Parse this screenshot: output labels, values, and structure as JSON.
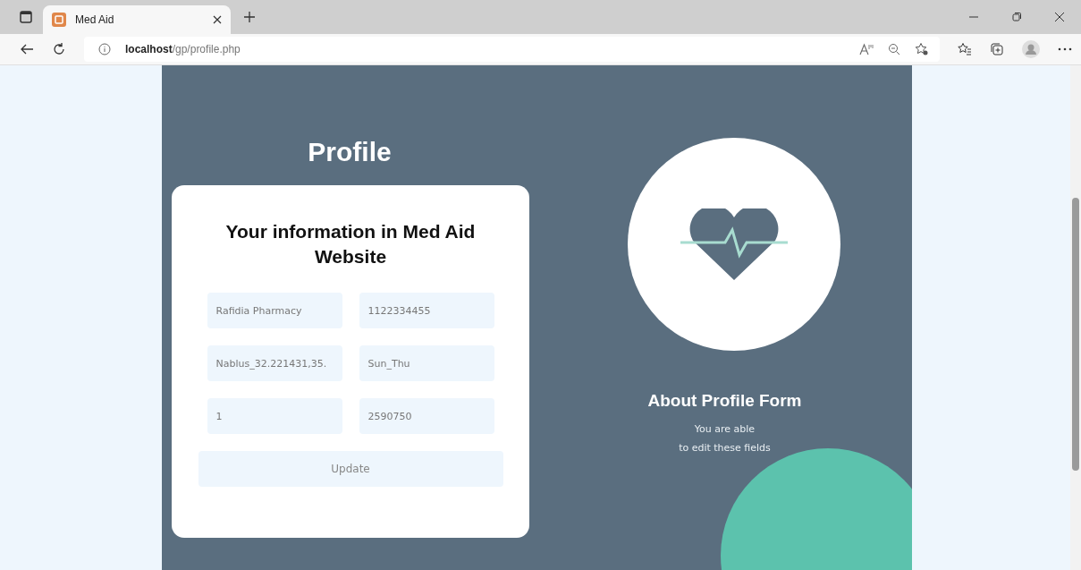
{
  "browser": {
    "tabs": [
      {
        "title": "Med Aid",
        "selected": true
      }
    ],
    "url": "**localhost**/gp/profile.php"
  },
  "page": {
    "title": "Profile",
    "form": {
      "heading": "Your information in Med Aid Website",
      "fields": [
        {
          "value": "Rafidia Pharmacy"
        },
        {
          "value": "1122334455"
        },
        {
          "value": "Nablus_32.221431,35."
        },
        {
          "value": "Sun_Thu"
        },
        {
          "value": "1"
        },
        {
          "value": "2590750"
        }
      ],
      "button": "Update"
    },
    "about": {
      "heading": "About Profile Form",
      "lines": [
        "You are able",
        "to edit these fields"
      ]
    }
  }
}
